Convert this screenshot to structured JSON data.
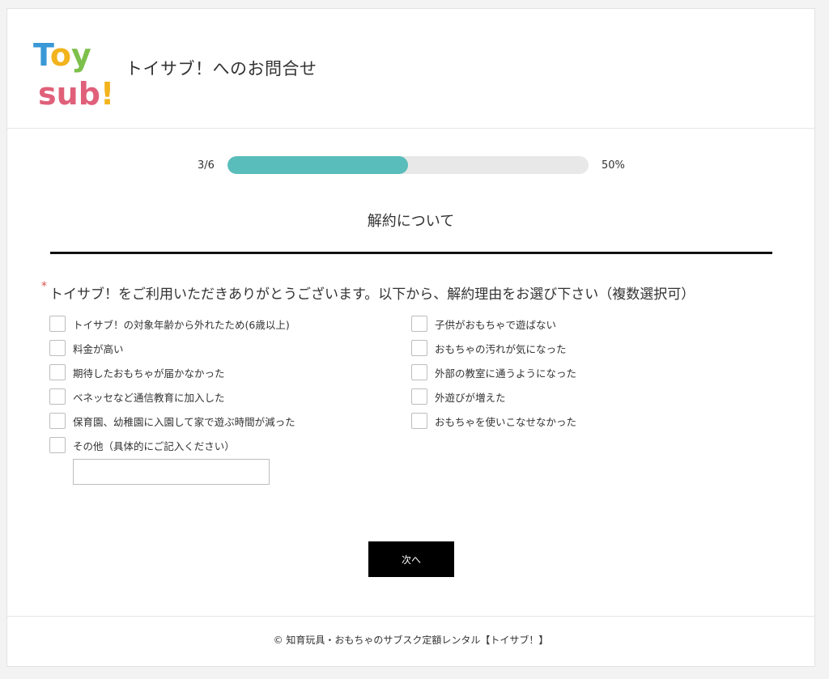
{
  "header": {
    "logo_text_line1": "Toy",
    "logo_text_line2": "sub!",
    "title": "トイサブ！へのお問合せ"
  },
  "progress": {
    "step": "3/6",
    "percent_label": "50%",
    "value": 0.5,
    "fill_color": "#59bdbb"
  },
  "section": {
    "title": "解約について"
  },
  "question": {
    "required_mark": "*",
    "text": "トイサブ！をご利用いただきありがとうございます。以下から、解約理由をお選び下さい（複数選択可）"
  },
  "options_left": [
    "トイサブ！の対象年齢から外れたため(6歳以上)",
    "料金が高い",
    "期待したおもちゃが届かなかった",
    "ベネッセなど通信教育に加入した",
    "保育園、幼稚園に入園して家で遊ぶ時間が減った",
    "その他（具体的にご記入ください）"
  ],
  "options_right": [
    "子供がおもちゃで遊ばない",
    "おもちゃの汚れが気になった",
    "外部の教室に通うようになった",
    "外遊びが増えた",
    "おもちゃを使いこなせなかった"
  ],
  "other_input": {
    "value": "",
    "placeholder": ""
  },
  "actions": {
    "next_label": "次へ"
  },
  "footer": {
    "text": "© 知育玩具・おもちゃのサブスク定額レンタル【トイサブ！】"
  },
  "colors": {
    "accent": "#59bdbb",
    "logo_blue": "#3a98d6",
    "logo_green": "#7dc04b",
    "logo_pink": "#e0607a",
    "logo_yellow": "#f2b31d",
    "required": "#d9534f"
  }
}
